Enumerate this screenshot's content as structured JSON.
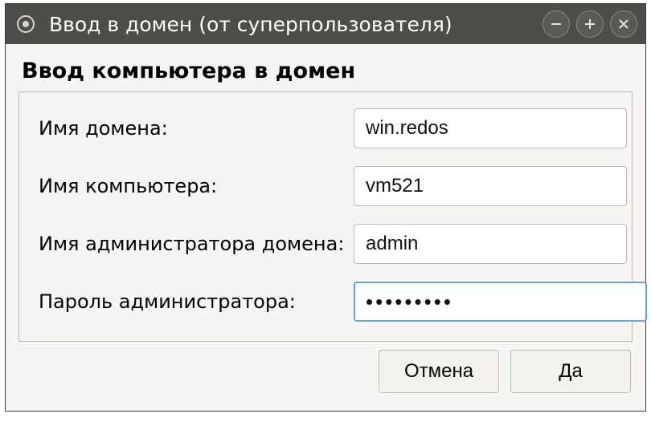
{
  "window": {
    "title": "Ввод в домен (от суперпользователя)"
  },
  "section_title": "Ввод компьютера в домен",
  "form": {
    "domain_label": "Имя домена:",
    "domain_value": "win.redos",
    "computer_label": "Имя компьютера:",
    "computer_value": "vm521",
    "admin_name_label": "Имя администратора домена:",
    "admin_name_value": "admin",
    "admin_pass_label": "Пароль администратора:",
    "admin_pass_value": "•••••••••"
  },
  "buttons": {
    "cancel": "Отмена",
    "ok": "Да"
  }
}
